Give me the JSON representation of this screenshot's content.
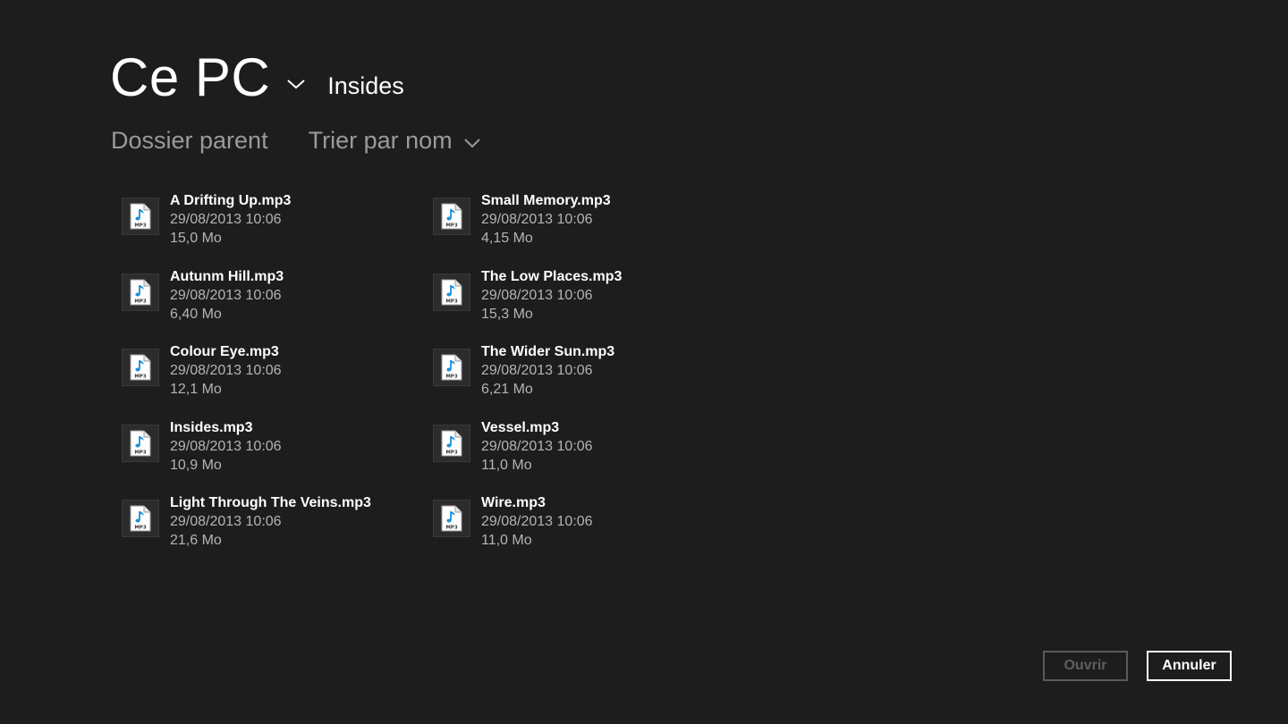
{
  "location": {
    "root": "Ce PC",
    "folder": "Insides"
  },
  "commands": {
    "parent_folder": "Dossier parent",
    "sort": "Trier par nom"
  },
  "files": [
    {
      "name": "A Drifting Up.mp3",
      "date": "29/08/2013 10:06",
      "size": "15,0 Mo",
      "icon": "mp3-file-icon"
    },
    {
      "name": "Autunm Hill.mp3",
      "date": "29/08/2013 10:06",
      "size": "6,40 Mo",
      "icon": "mp3-file-icon"
    },
    {
      "name": "Colour Eye.mp3",
      "date": "29/08/2013 10:06",
      "size": "12,1 Mo",
      "icon": "mp3-file-icon"
    },
    {
      "name": "Insides.mp3",
      "date": "29/08/2013 10:06",
      "size": "10,9 Mo",
      "icon": "mp3-file-icon"
    },
    {
      "name": "Light Through The Veins.mp3",
      "date": "29/08/2013 10:06",
      "size": "21,6 Mo",
      "icon": "mp3-file-icon"
    },
    {
      "name": "Small Memory.mp3",
      "date": "29/08/2013 10:06",
      "size": "4,15 Mo",
      "icon": "mp3-file-icon"
    },
    {
      "name": "The Low Places.mp3",
      "date": "29/08/2013 10:06",
      "size": "15,3 Mo",
      "icon": "mp3-file-icon"
    },
    {
      "name": "The Wider Sun.mp3",
      "date": "29/08/2013 10:06",
      "size": "6,21 Mo",
      "icon": "mp3-file-icon"
    },
    {
      "name": "Vessel.mp3",
      "date": "29/08/2013 10:06",
      "size": "11,0 Mo",
      "icon": "mp3-file-icon"
    },
    {
      "name": "Wire.mp3",
      "date": "29/08/2013 10:06",
      "size": "11,0 Mo",
      "icon": "mp3-file-icon"
    }
  ],
  "buttons": {
    "open": "Ouvrir",
    "cancel": "Annuler"
  },
  "colors": {
    "background": "#1d1d1d",
    "text": "#ffffff",
    "secondary_text": "#b4b4b4",
    "disabled": "#5f5f5f",
    "music_note": "#1e90d8"
  }
}
